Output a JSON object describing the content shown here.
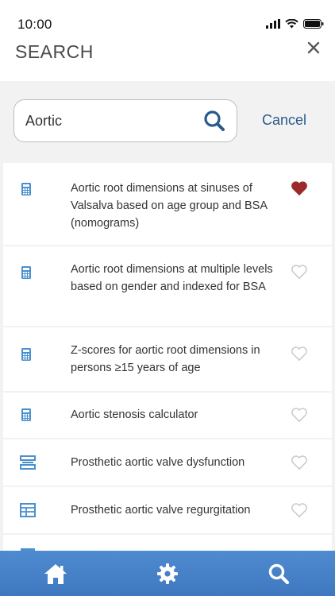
{
  "status": {
    "time": "10:00"
  },
  "header": {
    "title": "SEARCH"
  },
  "search": {
    "value": "Aortic",
    "cancel_label": "Cancel"
  },
  "results": [
    {
      "icon": "calculator-icon",
      "label": "Aortic root dimensions at sinuses of Valsalva based on age group and BSA (nomograms)",
      "favorite": true
    },
    {
      "icon": "calculator-icon",
      "label": "Aortic root dimensions at multiple levels based on gender and indexed for BSA",
      "favorite": false
    },
    {
      "icon": "calculator-icon",
      "label": "Z-scores for aortic root dimensions in persons ≥15 years of age",
      "favorite": false
    },
    {
      "icon": "calculator-icon",
      "label": "Aortic stenosis calculator",
      "favorite": false
    },
    {
      "icon": "algorithm-icon",
      "label": "Prosthetic aortic valve dysfunction",
      "favorite": false
    },
    {
      "icon": "table-icon",
      "label": "Prosthetic aortic valve regurgitation",
      "favorite": false
    }
  ],
  "tabbar": {
    "items": [
      "home-icon",
      "gear-icon",
      "search-icon"
    ]
  },
  "colors": {
    "accent_blue": "#4a90cf",
    "favorite_red": "#9c2a2a",
    "tabbar": "#4683c8",
    "link": "#2a5a8c"
  }
}
